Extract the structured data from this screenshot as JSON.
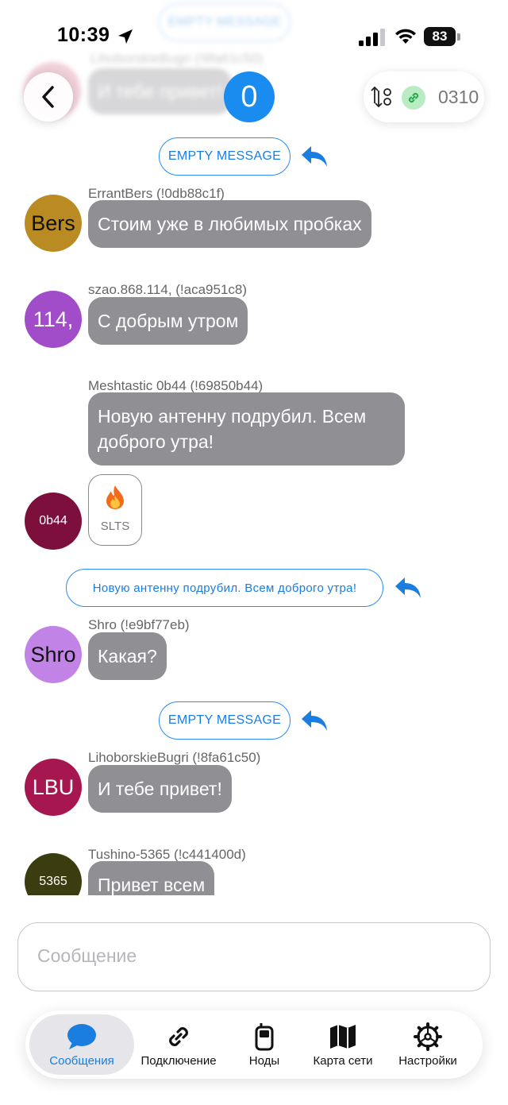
{
  "status_bar": {
    "time": "10:39",
    "battery": "83"
  },
  "header": {
    "channel_number": "0",
    "node_code": "0310"
  },
  "colors": {
    "accent": "#1a8cf0",
    "bubble": "#8f8f94",
    "link_badge": "#b9ecc3"
  },
  "messages": [
    {
      "type": "reply",
      "text": "EMPTY MESSAGE"
    },
    {
      "type": "message",
      "sender": "ErrantBers (!0db88c1f)",
      "avatar": "Bers",
      "avatar_color": "#b98b22",
      "text": "Стоим уже в любимых пробках"
    },
    {
      "type": "message",
      "sender": "szao.868.114, (!aca951c8)",
      "avatar": "114,",
      "avatar_color": "#a14cc9",
      "text": "С добрым утром"
    },
    {
      "type": "message",
      "sender": "Meshtastic 0b44 (!69850b44)",
      "avatar": "0b44",
      "avatar_color": "#7d0f3c",
      "text": "Новую антенну подрубил. Всем доброго утра!",
      "tapback": {
        "emoji": "🔥",
        "label": "SLTS"
      }
    },
    {
      "type": "reply",
      "text": "Новую антенну подрубил. Всем доброго утра!"
    },
    {
      "type": "message",
      "sender": "Shro (!e9bf77eb)",
      "avatar": "Shro",
      "avatar_color": "#c283e6",
      "text": "Какая?"
    },
    {
      "type": "reply",
      "text": "EMPTY MESSAGE"
    },
    {
      "type": "message",
      "sender": "LihoborskieBugri (!8fa61c50)",
      "avatar": "LBU",
      "avatar_color": "#a6174f",
      "text": "И тебе привет!"
    },
    {
      "type": "message",
      "sender": "Tushino-5365 (!c441400d)",
      "avatar": "5365",
      "avatar_color": "#3c3c11",
      "text": "Привет всем"
    }
  ],
  "ghost": {
    "reply": "EMPTY MESSAGE",
    "sender": "LihoborskieBugri (!8fa61c50)",
    "text": "И тебе привет!"
  },
  "input": {
    "placeholder": "Сообщение"
  },
  "tabs": [
    {
      "label": "Сообщения",
      "icon": "chat-bubble-icon",
      "active": true
    },
    {
      "label": "Подключение",
      "icon": "link-icon",
      "active": false
    },
    {
      "label": "Ноды",
      "icon": "radio-device-icon",
      "active": false
    },
    {
      "label": "Карта сети",
      "icon": "map-icon",
      "active": false
    },
    {
      "label": "Настройки",
      "icon": "gear-icon",
      "active": false
    }
  ]
}
